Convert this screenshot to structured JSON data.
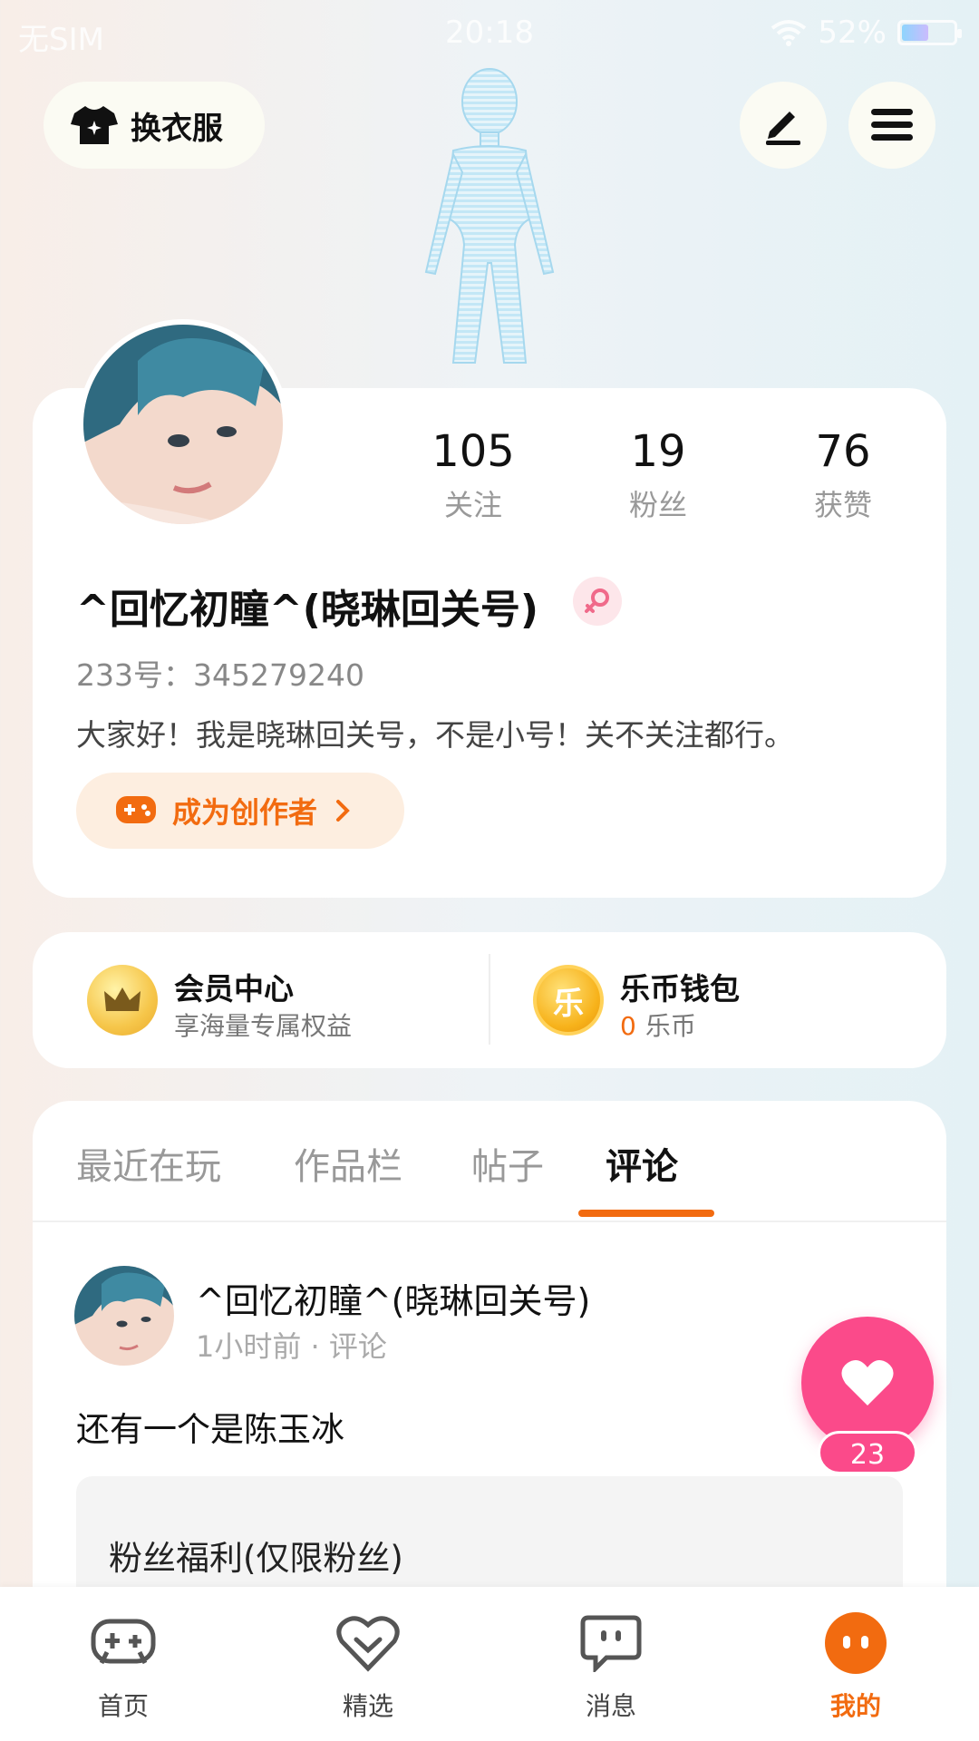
{
  "status_bar": {
    "carrier": "无SIM",
    "time": "20:18",
    "battery": "52%",
    "battery_level": 0.52
  },
  "header": {
    "outfit_label": "换衣服"
  },
  "profile": {
    "stats": [
      {
        "value": "105",
        "label": "关注"
      },
      {
        "value": "19",
        "label": "粉丝"
      },
      {
        "value": "76",
        "label": "获赞"
      }
    ],
    "nickname": "^回忆初瞳^(晓琳回关号)",
    "uid": "233号：345279240",
    "bio": "大家好！我是晓琳回关号，不是小号！关不关注都行。",
    "creator_label": "成为创作者"
  },
  "benefits": {
    "vip": {
      "title": "会员中心",
      "subtitle": "享海量专属权益"
    },
    "wallet": {
      "title": "乐币钱包",
      "amount": "0",
      "unit": "乐币",
      "coin_glyph": "乐"
    }
  },
  "tabs": [
    {
      "label": "最近在玩",
      "active": false
    },
    {
      "label": "作品栏",
      "active": false
    },
    {
      "label": "帖子",
      "active": false
    },
    {
      "label": "评论",
      "active": true
    }
  ],
  "post": {
    "author": "^回忆初瞳^(晓琳回关号)",
    "meta": "1小时前 · 评论",
    "text": "还有一个是陈玉冰",
    "quote": "粉丝福利(仅限粉丝)",
    "like_count": "23"
  },
  "bottom_nav": [
    {
      "label": "首页",
      "icon": "gamepad-icon"
    },
    {
      "label": "精选",
      "icon": "heart-shield-icon"
    },
    {
      "label": "消息",
      "icon": "chat-bubble-icon"
    },
    {
      "label": "我的",
      "icon": "smiley-icon",
      "active": true
    }
  ],
  "colors": {
    "accent": "#f26b10",
    "like": "#fb4a8a"
  }
}
